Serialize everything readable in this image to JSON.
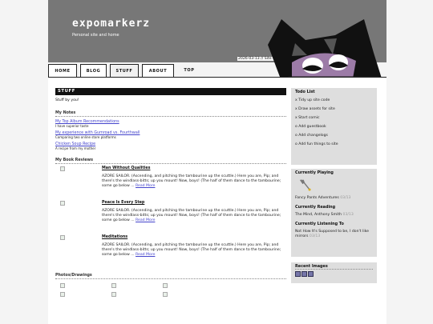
{
  "site": {
    "title": "expomarkerz",
    "subtitle": "Personal site and home",
    "dateline": "2026-03-13 // Site is"
  },
  "tabs": [
    "HOME",
    "BLOG",
    "STUFF",
    "ABOUT",
    "TOP"
  ],
  "page": {
    "heading": "STUFF",
    "intro": "Stuff by you!"
  },
  "notes": {
    "heading": "My Notes",
    "items": [
      {
        "title": "My Top Album Recommendations",
        "desc": "I have superior taste"
      },
      {
        "title": "My experience with Gumroad vs. Fourthwall",
        "desc": "Comparing two online store platforms"
      },
      {
        "title": "Chicken Soup Recipe",
        "desc": "A recipe from my mother"
      }
    ]
  },
  "reviews": {
    "heading": "My Book Reviews",
    "read_more": "Read More",
    "items": [
      {
        "title": "Man Without Qualities",
        "body": "AZORE SAILOR. (Ascending, and pitching the tambourine up the scuttle.) Here you are, Pip; and there's the windlass-bitts; up you mount! Now, boys! (The half of them dance to the tambourine; some go below ... "
      },
      {
        "title": "Peace Is Every Step",
        "body": "AZORE SAILOR. (Ascending, and pitching the tambourine up the scuttle.) Here you are, Pip; and there's the windlass-bitts; up you mount! Now, boys! (The half of them dance to the tambourine; some go below ... "
      },
      {
        "title": "Meditations",
        "body": "AZORE SAILOR. (Ascending, and pitching the tambourine up the scuttle.) Here you are, Pip; and there's the windlass-bitts; up you mount! Now, boys! (The half of them dance to the tambourine; some go below ... "
      }
    ]
  },
  "photos": {
    "heading": "Photos/Drawings"
  },
  "todo": {
    "heading": "Todo List",
    "items": [
      "x Tidy up site code",
      "x Draw assets for site",
      "x Start comic",
      "o Add guestbook",
      "o Add changelogs",
      "o Add fun things to site"
    ]
  },
  "playing": {
    "heading": "Currently Playing",
    "title": "Fancy Pants Adventures",
    "date": "03/13"
  },
  "reading": {
    "heading": "Currently Reading",
    "title": "The Mind, Anthony Smith",
    "date": "03/13"
  },
  "listening": {
    "heading": "Currently Listening To",
    "title": "Not How It's Supposed to be, I don't like mirrors",
    "date": "03/13"
  },
  "recent": {
    "heading": "Recent Images"
  }
}
